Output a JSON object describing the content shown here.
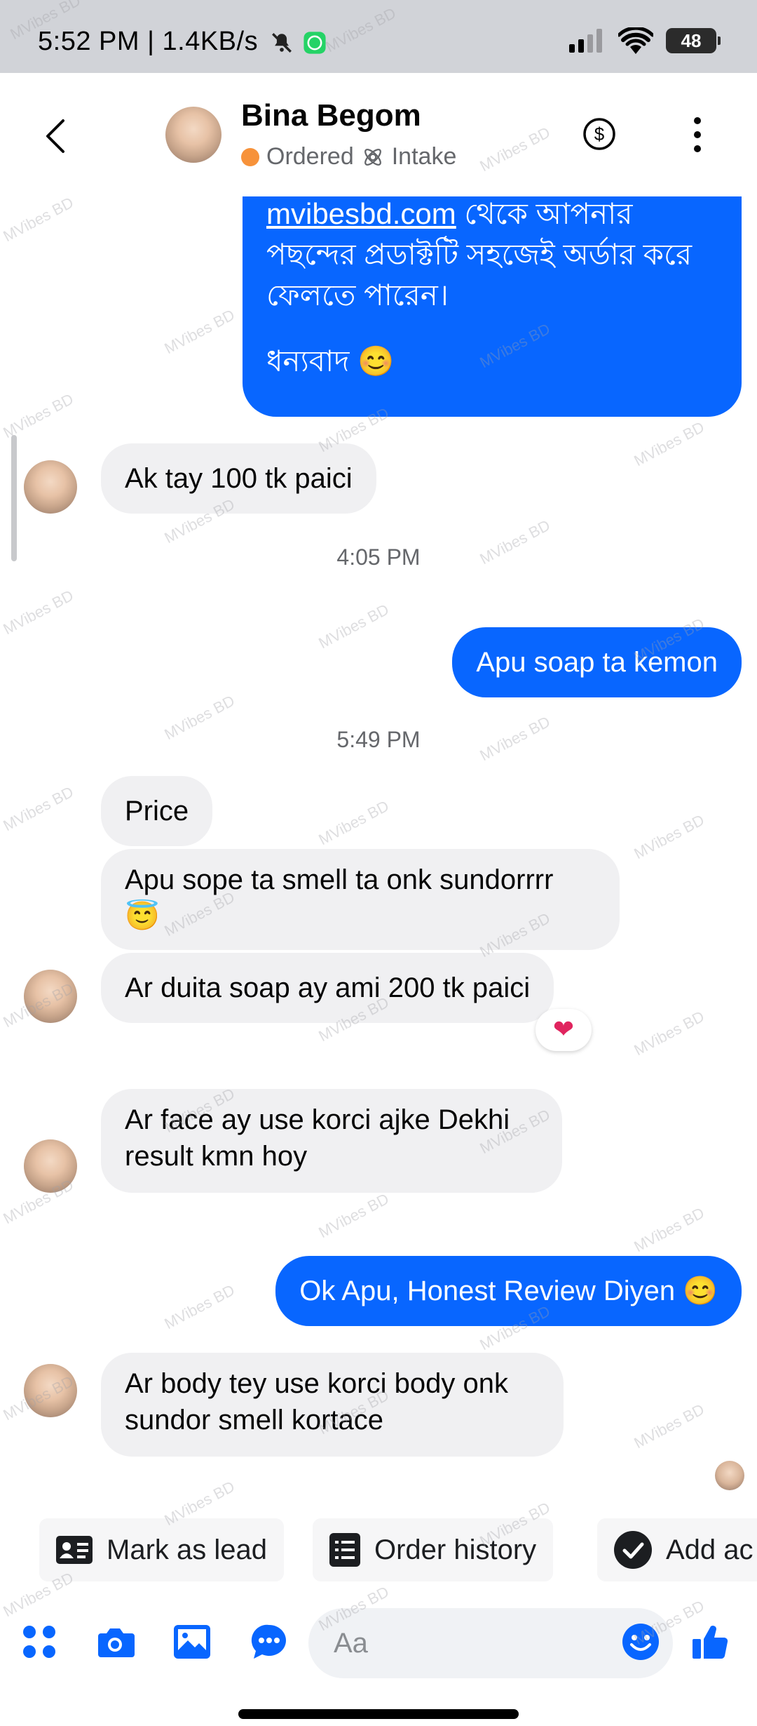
{
  "status_bar": {
    "time_text": "5:52 PM | 1.4KB/s",
    "battery": "48",
    "icons": [
      "mute-icon",
      "whatsapp-icon",
      "signal-icon",
      "wifi-icon",
      "battery-icon"
    ]
  },
  "header": {
    "name": "Bina Begom",
    "tag_ordered": "Ordered",
    "tag_intake": "Intake",
    "accent": "#0866ff",
    "tag_color": "#f7923a"
  },
  "messages": {
    "out1_link": "mvibesbd.com",
    "out1_text_a": " থেকে আপনার পছন্দের প্রডাক্টটি সহজেই অর্ডার করে ফেলতে পারেন।",
    "out1_text_b": "ধন্যবাদ 😊",
    "in1": "Ak tay  100 tk paici",
    "time1": "4:05 PM",
    "out2": "Apu soap ta kemon",
    "time2": "5:49 PM",
    "in2": "Price",
    "in3": "Apu sope ta smell ta onk sundorrrr 😇",
    "in4": "Ar duita soap ay ami 200 tk paici",
    "in4_reaction": "❤",
    "in5": "Ar face ay use korci ajke Dekhi result kmn hoy",
    "out3": "Ok Apu, Honest Review Diyen 😊",
    "in6": "Ar body tey use korci body onk sundor smell kortace"
  },
  "chips": {
    "mark_as_lead": "Mark as lead",
    "order_history": "Order history",
    "add_ad": "Add ac"
  },
  "composer": {
    "placeholder": "Aa"
  },
  "watermark": "MVibes BD"
}
